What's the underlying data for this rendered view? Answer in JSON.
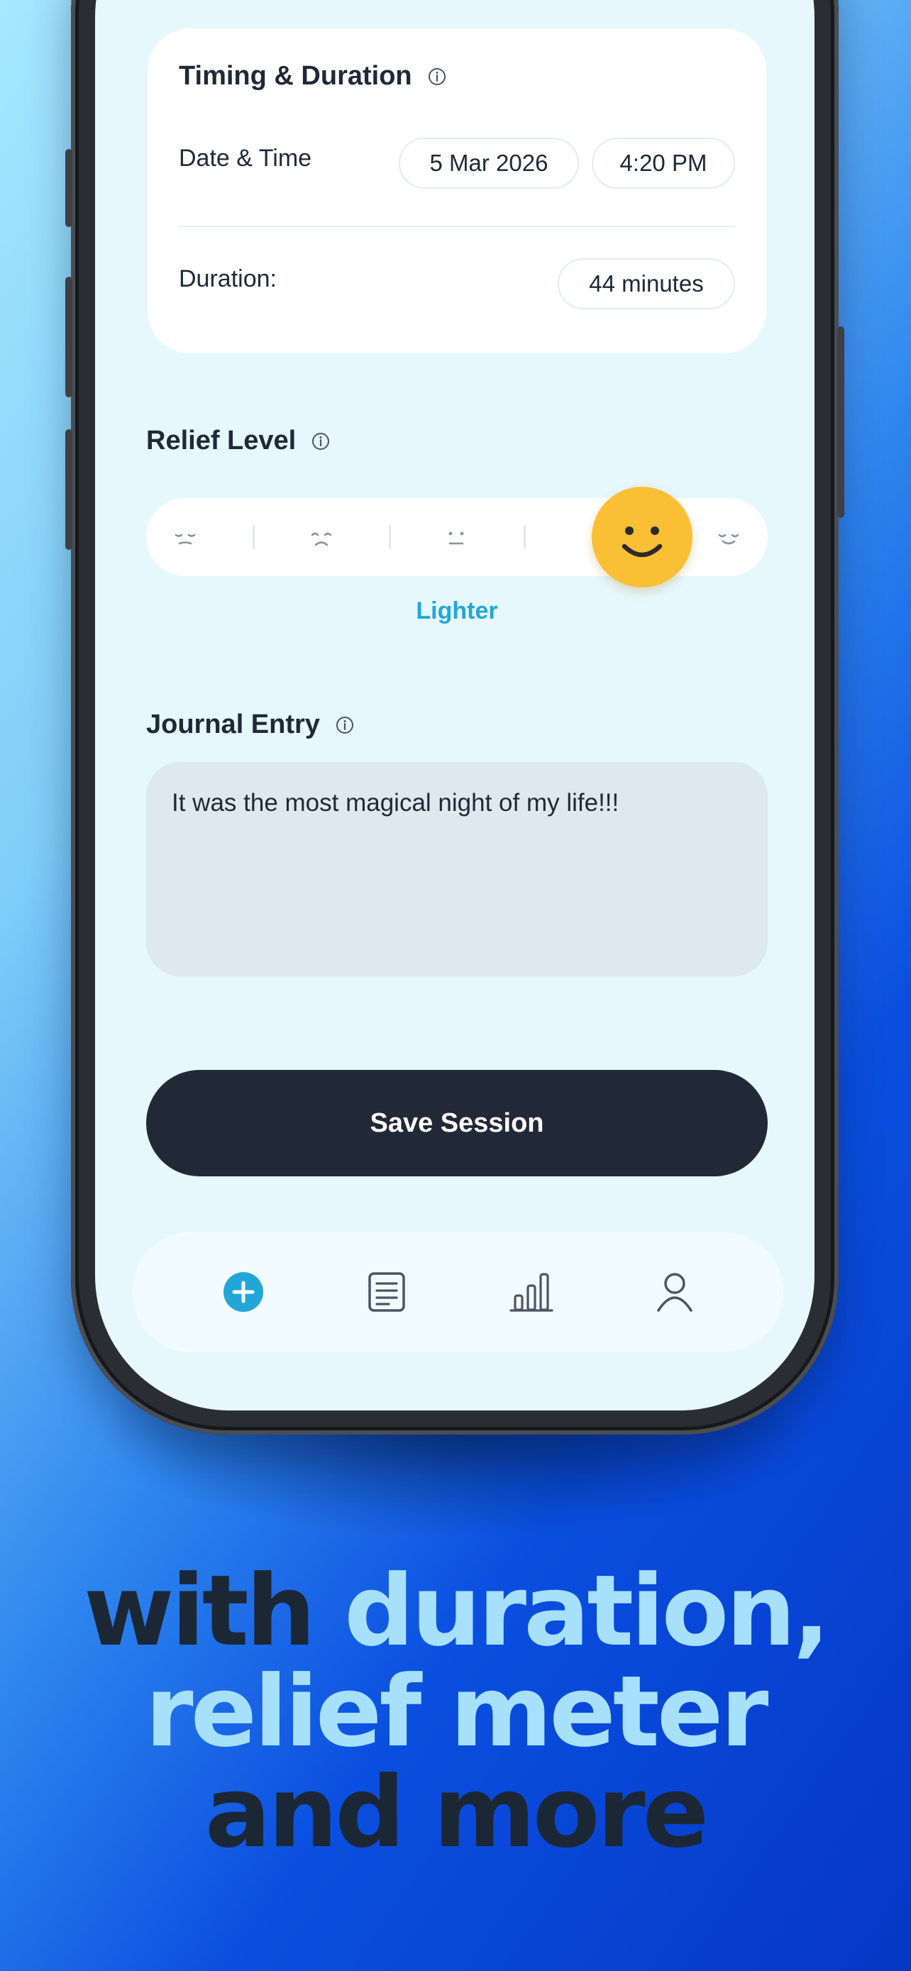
{
  "timing": {
    "title": "Timing & Duration",
    "date_time_label": "Date & Time",
    "date": "5 Mar 2026",
    "time": "4:20 PM",
    "duration_label": "Duration:",
    "duration": "44 minutes"
  },
  "relief": {
    "title": "Relief Level",
    "selected_label": "Lighter",
    "selected_index": 3,
    "levels_count": 5
  },
  "journal": {
    "title": "Journal Entry",
    "text": "It was the most magical night of my life!!!"
  },
  "actions": {
    "save_label": "Save Session"
  },
  "tabs": [
    {
      "icon": "plus-circle-icon",
      "active": true
    },
    {
      "icon": "journal-icon",
      "active": false
    },
    {
      "icon": "bar-chart-icon",
      "active": false
    },
    {
      "icon": "profile-icon",
      "active": false
    }
  ],
  "headline": {
    "line1_dark": "with",
    "line1_light": "duration,",
    "line2_light": "relief meter",
    "line3_dark": "and more"
  },
  "colors": {
    "accent": "#22a6d8",
    "knob": "#fbbf36",
    "button": "#212936",
    "headline_dark": "#1c2736",
    "headline_light": "#a6e0fb"
  }
}
